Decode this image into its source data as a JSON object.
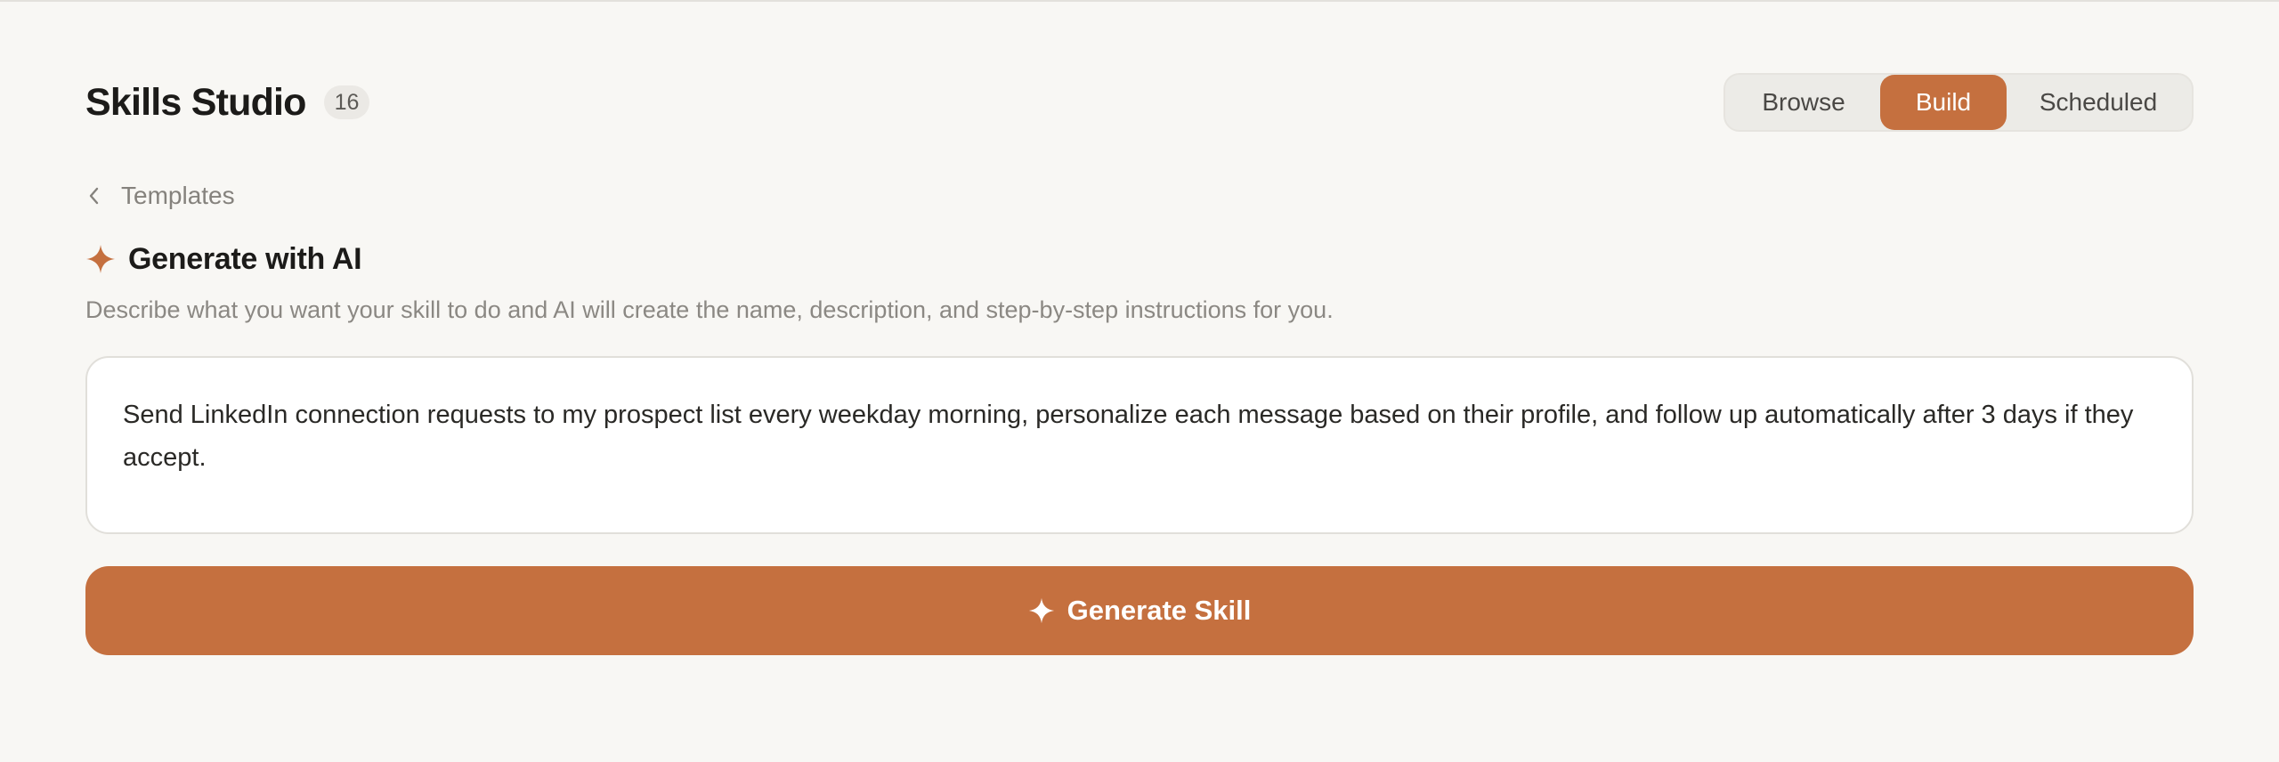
{
  "header": {
    "title": "Skills Studio",
    "count": "16"
  },
  "tabs": [
    {
      "label": "Browse",
      "active": false
    },
    {
      "label": "Build",
      "active": true
    },
    {
      "label": "Scheduled",
      "active": false
    }
  ],
  "breadcrumb": {
    "back_label": "Templates"
  },
  "generator": {
    "icon": "sparkle-icon",
    "title": "Generate with AI",
    "description": "Describe what you want your skill to do and AI will create the name, description, and step-by-step instructions for you.",
    "prompt_value": "Send LinkedIn connection requests to my prospect list every weekday morning, personalize each message based on their profile, and follow up automatically after 3 days if they accept.",
    "button_label": "Generate Skill"
  },
  "colors": {
    "accent": "#c5703f",
    "background": "#f8f7f4"
  }
}
